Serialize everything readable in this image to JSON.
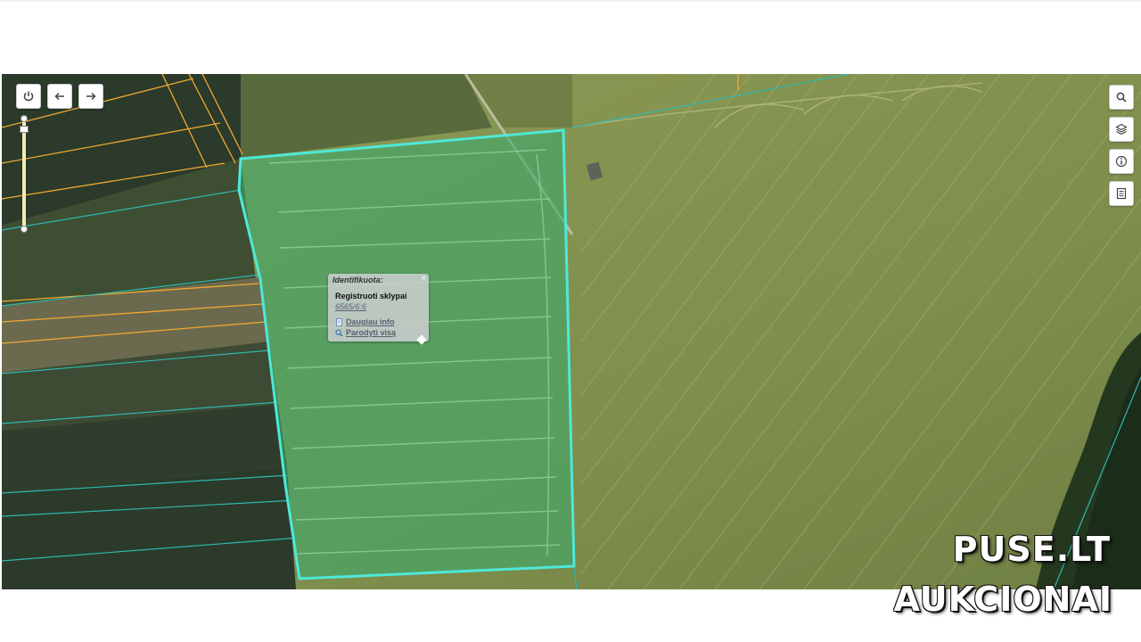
{
  "map": {
    "controls_left": {
      "power_icon": "power-icon",
      "back_icon": "arrow-left-icon",
      "forward_icon": "arrow-right-icon"
    },
    "controls_right": {
      "search_icon": "search-icon",
      "layers_icon": "layers-icon",
      "info_icon": "info-icon",
      "legend_icon": "document-list-icon"
    },
    "zoom_level_fraction": 0.1,
    "colors": {
      "parcel_outline": "#4fe8d8",
      "parcel_fill": "#3fa86a",
      "cadastre_lines_orange": "#f0a830",
      "cadastre_lines_teal": "#2fb8b0"
    }
  },
  "popup": {
    "title": "Identifikuota:",
    "close": "×",
    "heading": "Registruoti sklypai",
    "parcel_id": "6565/6:6",
    "more_info": "Daugiau info",
    "show_all": "Parodyti visą"
  },
  "watermark": {
    "line1": "PUSE.LT",
    "line2": "AUKCIONAI"
  }
}
